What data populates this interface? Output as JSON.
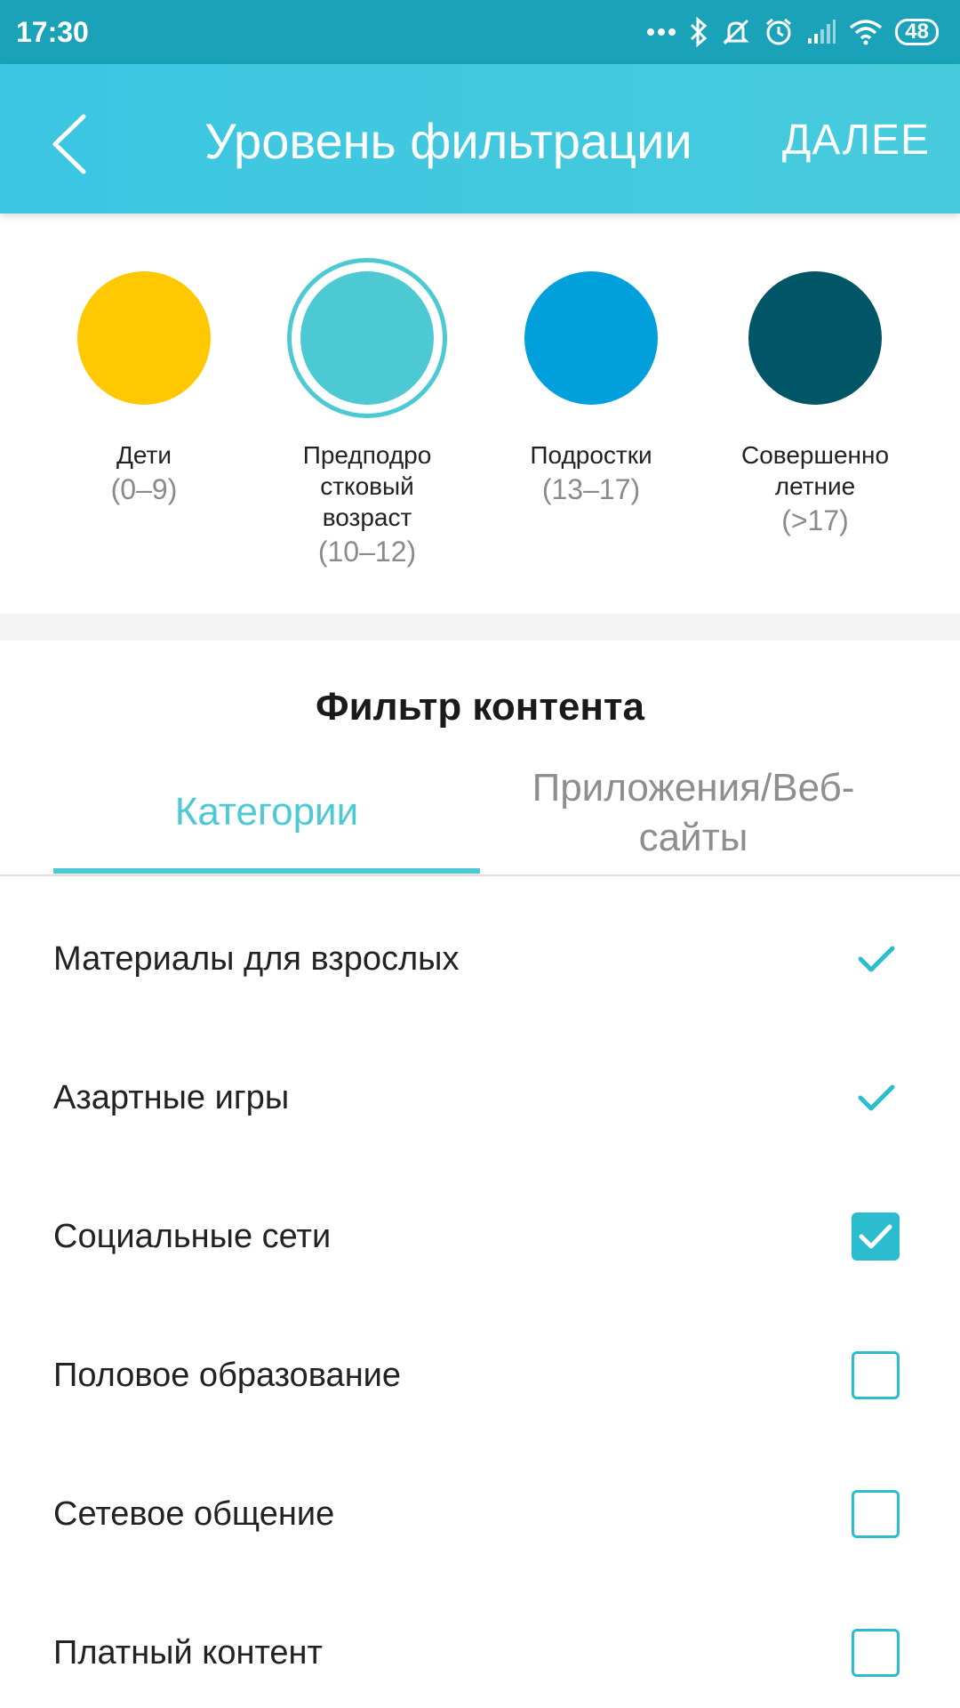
{
  "status_bar": {
    "time": "17:30",
    "battery": "48",
    "icons": [
      "more-dots-icon",
      "bluetooth-icon",
      "mute-icon",
      "alarm-icon",
      "signal-icon",
      "wifi-icon",
      "battery-icon"
    ]
  },
  "app_bar": {
    "back_icon": "chevron-left-icon",
    "title": "Уровень фильтрации",
    "next_label": "ДАЛЕЕ"
  },
  "levels": [
    {
      "name": "Дети",
      "range": "(0–9)",
      "color": "#ffc800",
      "selected": false
    },
    {
      "name": "Предподростковый возраст",
      "name_lines": [
        "Предподро",
        "стковый",
        "возраст"
      ],
      "range": "(10–12)",
      "color": "#4cc9d3",
      "selected": true
    },
    {
      "name": "Подростки",
      "range": "(13–17)",
      "color": "#00a0dc",
      "selected": false
    },
    {
      "name": "Совершеннолетние",
      "name_lines": [
        "Совершенно",
        "летние"
      ],
      "range": "(>17)",
      "color": "#005566",
      "selected": false
    }
  ],
  "filter": {
    "title": "Фильтр контента",
    "tabs": [
      {
        "label": "Категории",
        "active": true
      },
      {
        "label": "Приложения/Веб-сайты",
        "label_lines": [
          "Приложения/Веб-",
          "сайты"
        ],
        "active": false
      }
    ],
    "categories": [
      {
        "label": "Материалы для взрослых",
        "state": "checked-locked"
      },
      {
        "label": "Азартные игры",
        "state": "checked-locked"
      },
      {
        "label": "Социальные сети",
        "state": "checked"
      },
      {
        "label": "Половое образование",
        "state": "unchecked"
      },
      {
        "label": "Сетевое общение",
        "state": "unchecked"
      },
      {
        "label": "Платный контент",
        "state": "unchecked"
      }
    ]
  },
  "colors": {
    "accent": "#4cc9d3",
    "status_bar": "#1aa3b8",
    "app_bar": "#3cc6e2",
    "check": "#2bbccf"
  }
}
